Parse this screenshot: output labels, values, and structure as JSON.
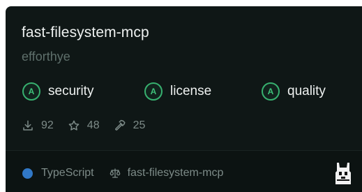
{
  "card": {
    "title": "fast-filesystem-mcp",
    "author": "efforthye",
    "badges": [
      {
        "grade": "A",
        "label": "security"
      },
      {
        "grade": "A",
        "label": "license"
      },
      {
        "grade": "A",
        "label": "quality"
      }
    ],
    "stats": {
      "downloads": "92",
      "stars": "48",
      "tools": "25"
    },
    "footer": {
      "language": "TypeScript",
      "license_name": "fast-filesystem-mcp"
    },
    "colors": {
      "background": "#0f1716",
      "badge_accent": "#37b06f",
      "language_dot": "#3178c6"
    },
    "icons": [
      "download-icon",
      "star-icon",
      "hammer-icon",
      "scale-icon",
      "llama-mascot-icon"
    ]
  }
}
